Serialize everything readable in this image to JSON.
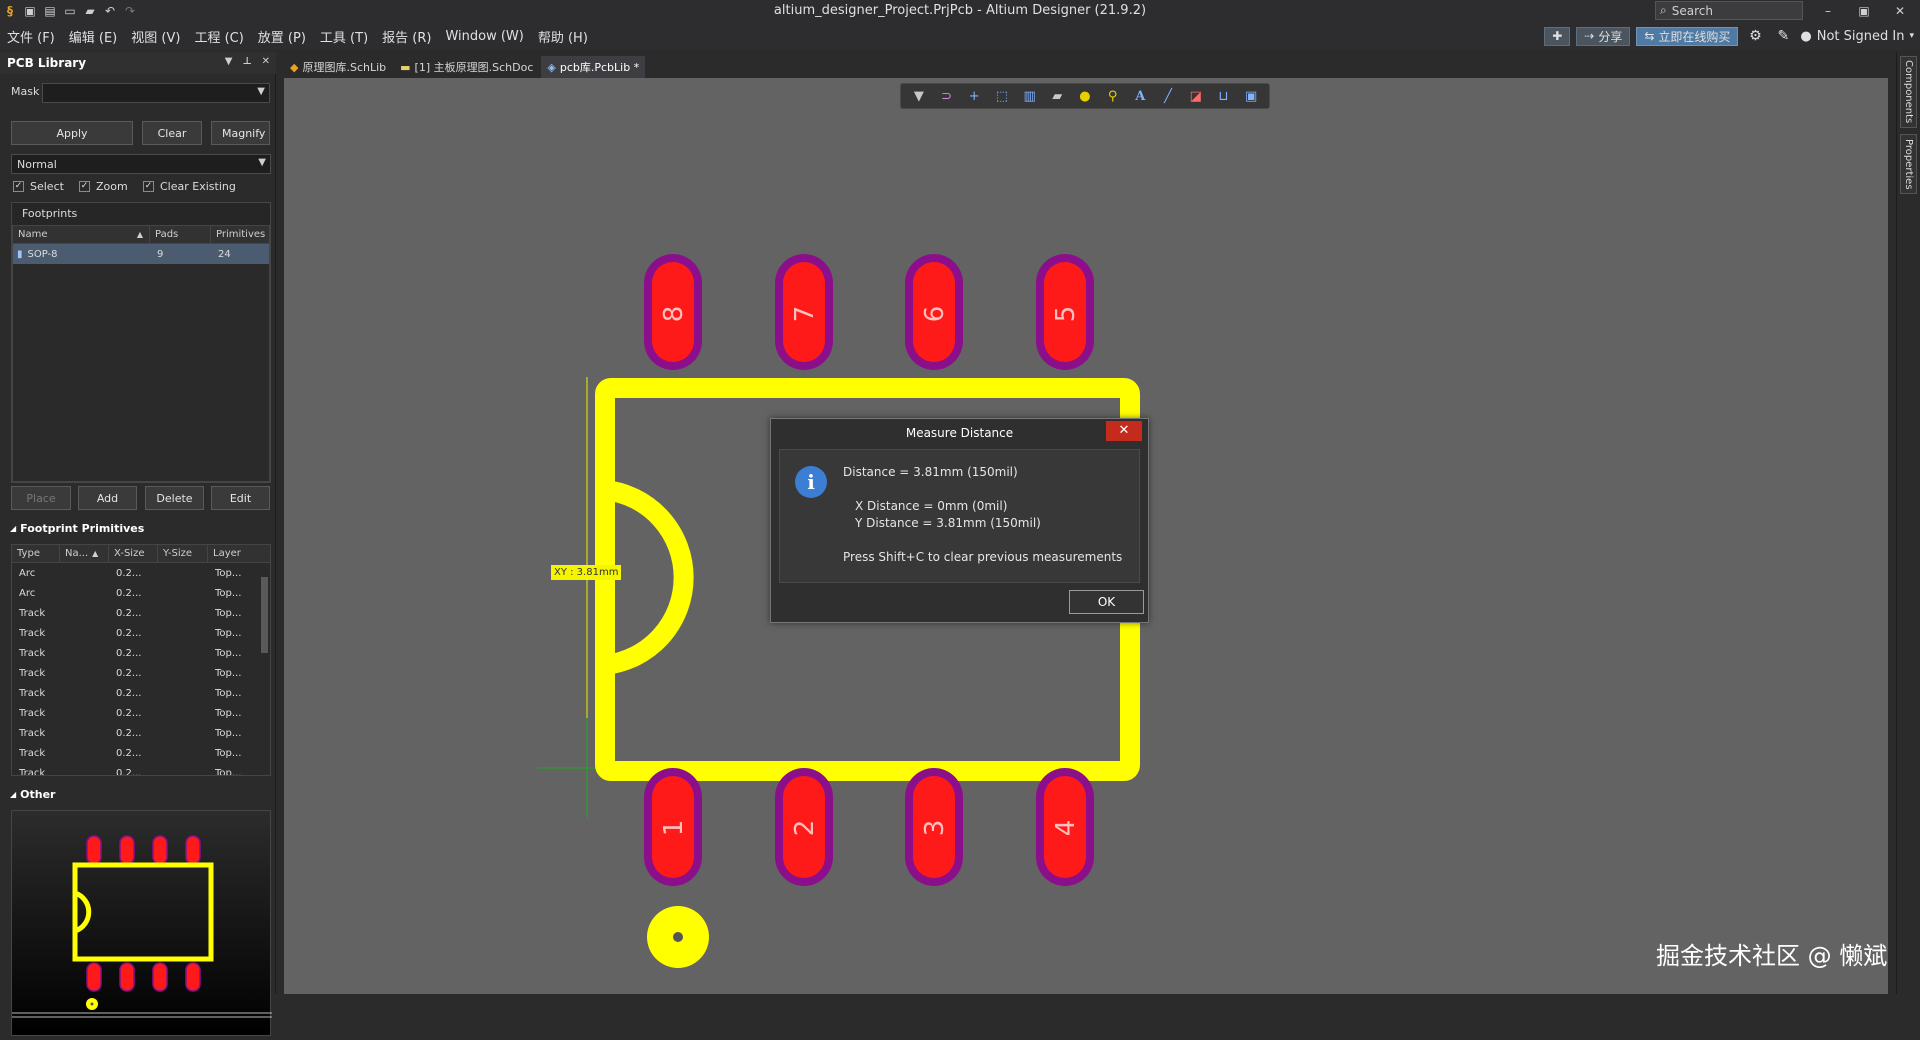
{
  "window": {
    "title": "altium_designer_Project.PrjPcb - Altium Designer (21.9.2)",
    "search_placeholder": "Search",
    "minimize": "–",
    "maximize": "▣",
    "close": "✕"
  },
  "menu": [
    "文件 (F)",
    "编辑 (E)",
    "视图 (V)",
    "工程 (C)",
    "放置 (P)",
    "工具 (T)",
    "报告 (R)",
    "Window (W)",
    "帮助 (H)"
  ],
  "top_right": {
    "share": "分享",
    "buy": "立即在线购买",
    "signin": "Not Signed In"
  },
  "panel": {
    "title": "PCB Library",
    "mask_label": "Mask",
    "mask_value": "",
    "apply": "Apply",
    "clear": "Clear",
    "magnify": "Magnify",
    "mode": "Normal",
    "checkboxes": {
      "select": "Select",
      "zoom": "Zoom",
      "clear_existing": "Clear Existing"
    },
    "footprints_title": "Footprints",
    "footprints_columns": [
      "Name",
      "Pads",
      "Primitives"
    ],
    "footprints_rows": [
      {
        "name": "SOP-8",
        "pads": "9",
        "primitives": "24"
      }
    ],
    "place": "Place",
    "add": "Add",
    "delete": "Delete",
    "edit": "Edit",
    "primitives_title": "Footprint Primitives",
    "primitives_columns": [
      "Type",
      "Na...",
      "X-Size",
      "Y-Size",
      "Layer"
    ],
    "primitives_rows": [
      {
        "type": "Arc",
        "x": "0.2...",
        "layer": "Top..."
      },
      {
        "type": "Arc",
        "x": "0.2...",
        "layer": "Top..."
      },
      {
        "type": "Track",
        "x": "0.2...",
        "layer": "Top..."
      },
      {
        "type": "Track",
        "x": "0.2...",
        "layer": "Top..."
      },
      {
        "type": "Track",
        "x": "0.2...",
        "layer": "Top..."
      },
      {
        "type": "Track",
        "x": "0.2...",
        "layer": "Top..."
      },
      {
        "type": "Track",
        "x": "0.2...",
        "layer": "Top..."
      },
      {
        "type": "Track",
        "x": "0.2...",
        "layer": "Top..."
      },
      {
        "type": "Track",
        "x": "0.2...",
        "layer": "Top..."
      },
      {
        "type": "Track",
        "x": "0.2...",
        "layer": "Top..."
      },
      {
        "type": "Track",
        "x": "0.2...",
        "layer": "Top..."
      }
    ],
    "other_title": "Other"
  },
  "doc_tabs": [
    {
      "label": "原理图库.SchLib",
      "icon": "schlib-icon"
    },
    {
      "label": "[1] 主板原理图.SchDoc",
      "icon": "schdoc-icon"
    },
    {
      "label": "pcb库.PcbLib *",
      "icon": "pcblib-icon"
    }
  ],
  "right_dock": [
    "Components",
    "Properties"
  ],
  "pads_top": [
    "8",
    "7",
    "6",
    "5"
  ],
  "pads_bottom": [
    "1",
    "2",
    "3",
    "4"
  ],
  "xy_label": "XY : 3.81mm",
  "dialog": {
    "title": "Measure Distance",
    "close": "✕",
    "distance": "Distance = 3.81mm (150mil)",
    "x_distance": "X Distance = 0mm (0mil)",
    "y_distance": "Y Distance = 3.81mm (150mil)",
    "hint": "Press Shift+C to clear previous measurements",
    "ok": "OK"
  },
  "watermark": "掘金技术社区 @ 懒斌",
  "colors": {
    "pad_red": "#ff1a1a",
    "pad_ring": "#8b0f8b",
    "silkscreen": "#ffff00",
    "canvas": "#636363"
  }
}
